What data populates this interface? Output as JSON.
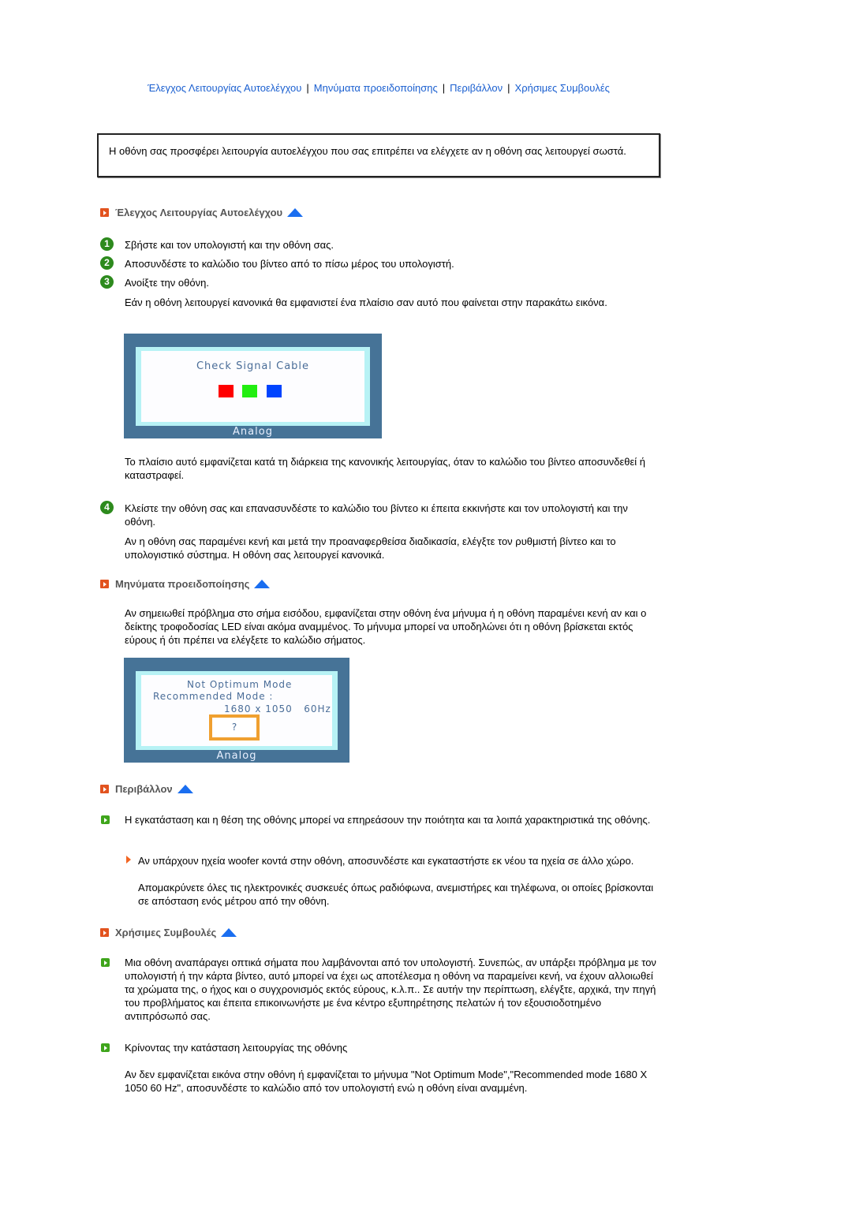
{
  "nav": {
    "links": [
      "Έλεγχος Λειτουργίας Αυτοελέγχου",
      "Μηνύματα προειδοποίησης",
      "Περιβάλλον",
      "Χρήσιμες Συμβουλές"
    ],
    "separator": "|"
  },
  "intro": "Η οθόνη σας προσφέρει λειτουργία αυτοελέγχου που σας επιτρέπει να ελέγχετε αν η οθόνη σας λειτουργεί σωστά.",
  "colors": {
    "link": "#1a5fd0",
    "section_bullet": "#e2531f",
    "up_arrow": "#1a6ef0",
    "step_icon": "#2d8a1d",
    "osd_frame": "#467397",
    "osd_inner": "#b7f2f5",
    "question_box": "#f0a030"
  },
  "self_test": {
    "heading": "Έλεγχος Λειτουργίας Αυτοελέγχου",
    "steps": [
      {
        "num": "1",
        "text": "Σβήστε και τον υπολογιστή και την οθόνη σας."
      },
      {
        "num": "2",
        "text": "Αποσυνδέστε το καλώδιο του βίντεο από το πίσω μέρος του υπολογιστή."
      },
      {
        "num": "3",
        "text": "Ανοίξτε την οθόνη."
      }
    ],
    "step3_note": "Εάν η οθόνη λειτουργεί κανονικά θα εμφανιστεί ένα πλαίσιο σαν αυτό που φαίνεται στην παρακάτω εικόνα.",
    "osd": {
      "message": "Check Signal Cable",
      "footer": "Analog",
      "swatches": [
        "#ff0000",
        "#22ee11",
        "#0044ff"
      ]
    },
    "after_osd": "Το πλαίσιο αυτό εμφανίζεται κατά τη διάρκεια της κανονικής λειτουργίας, όταν το καλώδιο του βίντεο αποσυνδεθεί ή καταστραφεί.",
    "step4": {
      "num": "4",
      "text": "Κλείστε την οθόνη σας και επανασυνδέστε το καλώδιο του βίντεο κι έπειτα εκκινήστε και τον υπολογιστή και την οθόνη."
    },
    "step4_note": "Αν η οθόνη σας παραμένει κενή και μετά την προαναφερθείσα διαδικασία, ελέγξτε τον ρυθμιστή βίντεο και το υπολογιστικό σύστημα. Η οθόνη σας λειτουργεί κανονικά."
  },
  "warnings": {
    "heading": "Μηνύματα προειδοποίησης",
    "text": "Αν σημειωθεί πρόβλημα στο σήμα εισόδου, εμφανίζεται στην οθόνη ένα μήνυμα ή η οθόνη παραμένει κενή αν και ο δείκτης τροφοδοσίας LED είναι ακόμα αναμμένος. Το μήνυμα μπορεί να υποδηλώνει ότι η οθόνη βρίσκεται εκτός εύρους ή ότι πρέπει να ελέγξετε το καλώδιο σήματος.",
    "osd": {
      "line1": "Not Optimum Mode",
      "line2": "Recommended Mode :",
      "line3": "1680 x 1050   60Hz",
      "question": "?",
      "footer": "Analog"
    }
  },
  "environment": {
    "heading": "Περιβάλλον",
    "text": "Η εγκατάσταση και η θέση της οθόνης μπορεί να επηρεάσουν την ποιότητα και τα λοιπά χαρακτηριστικά της οθόνης.",
    "sub_text1": "Αν υπάρχουν ηχεία woofer κοντά στην οθόνη, αποσυνδέστε και εγκαταστήστε εκ νέου τα ηχεία σε άλλο χώρο.",
    "sub_text2": "Απομακρύνετε όλες τις ηλεκτρονικές συσκευές όπως ραδιόφωνα, ανεμιστήρες και τηλέφωνα, οι οποίες βρίσκονται σε απόσταση ενός μέτρου από την οθόνη."
  },
  "tips": {
    "heading": "Χρήσιμες Συμβουλές",
    "text1": "Μια οθόνη αναπάραγει οπτικά σήματα που λαμβάνονται από τον υπολογιστή. Συνεπώς, αν υπάρξει πρόβλημα με τον υπολογιστή ή την κάρτα βίντεο, αυτό μπορεί να έχει ως αποτέλεσμα η οθόνη να παραμείνει κενή, να έχουν αλλοιωθεί τα χρώματα της, ο ήχος και ο συγχρονισμός εκτός εύρους, κ.λ.π.. Σε αυτήν την περίπτωση, ελέγξτε, αρχικά, την πηγή του προβλήματος και έπειτα επικοινωνήστε με ένα κέντρο εξυπηρέτησης πελατών ή τον εξουσιοδοτημένο αντιπρόσωπό σας.",
    "text2": "Κρίνοντας την κατάσταση λειτουργίας της οθόνης",
    "text3": "Αν δεν εμφανίζεται εικόνα στην οθόνη ή εμφανίζεται το μήνυμα \"Not Optimum Mode\",\"Recommended mode 1680 X 1050 60 Hz\", αποσυνδέστε το καλώδιο από τον υπολογιστή ενώ η οθόνη είναι αναμμένη."
  }
}
